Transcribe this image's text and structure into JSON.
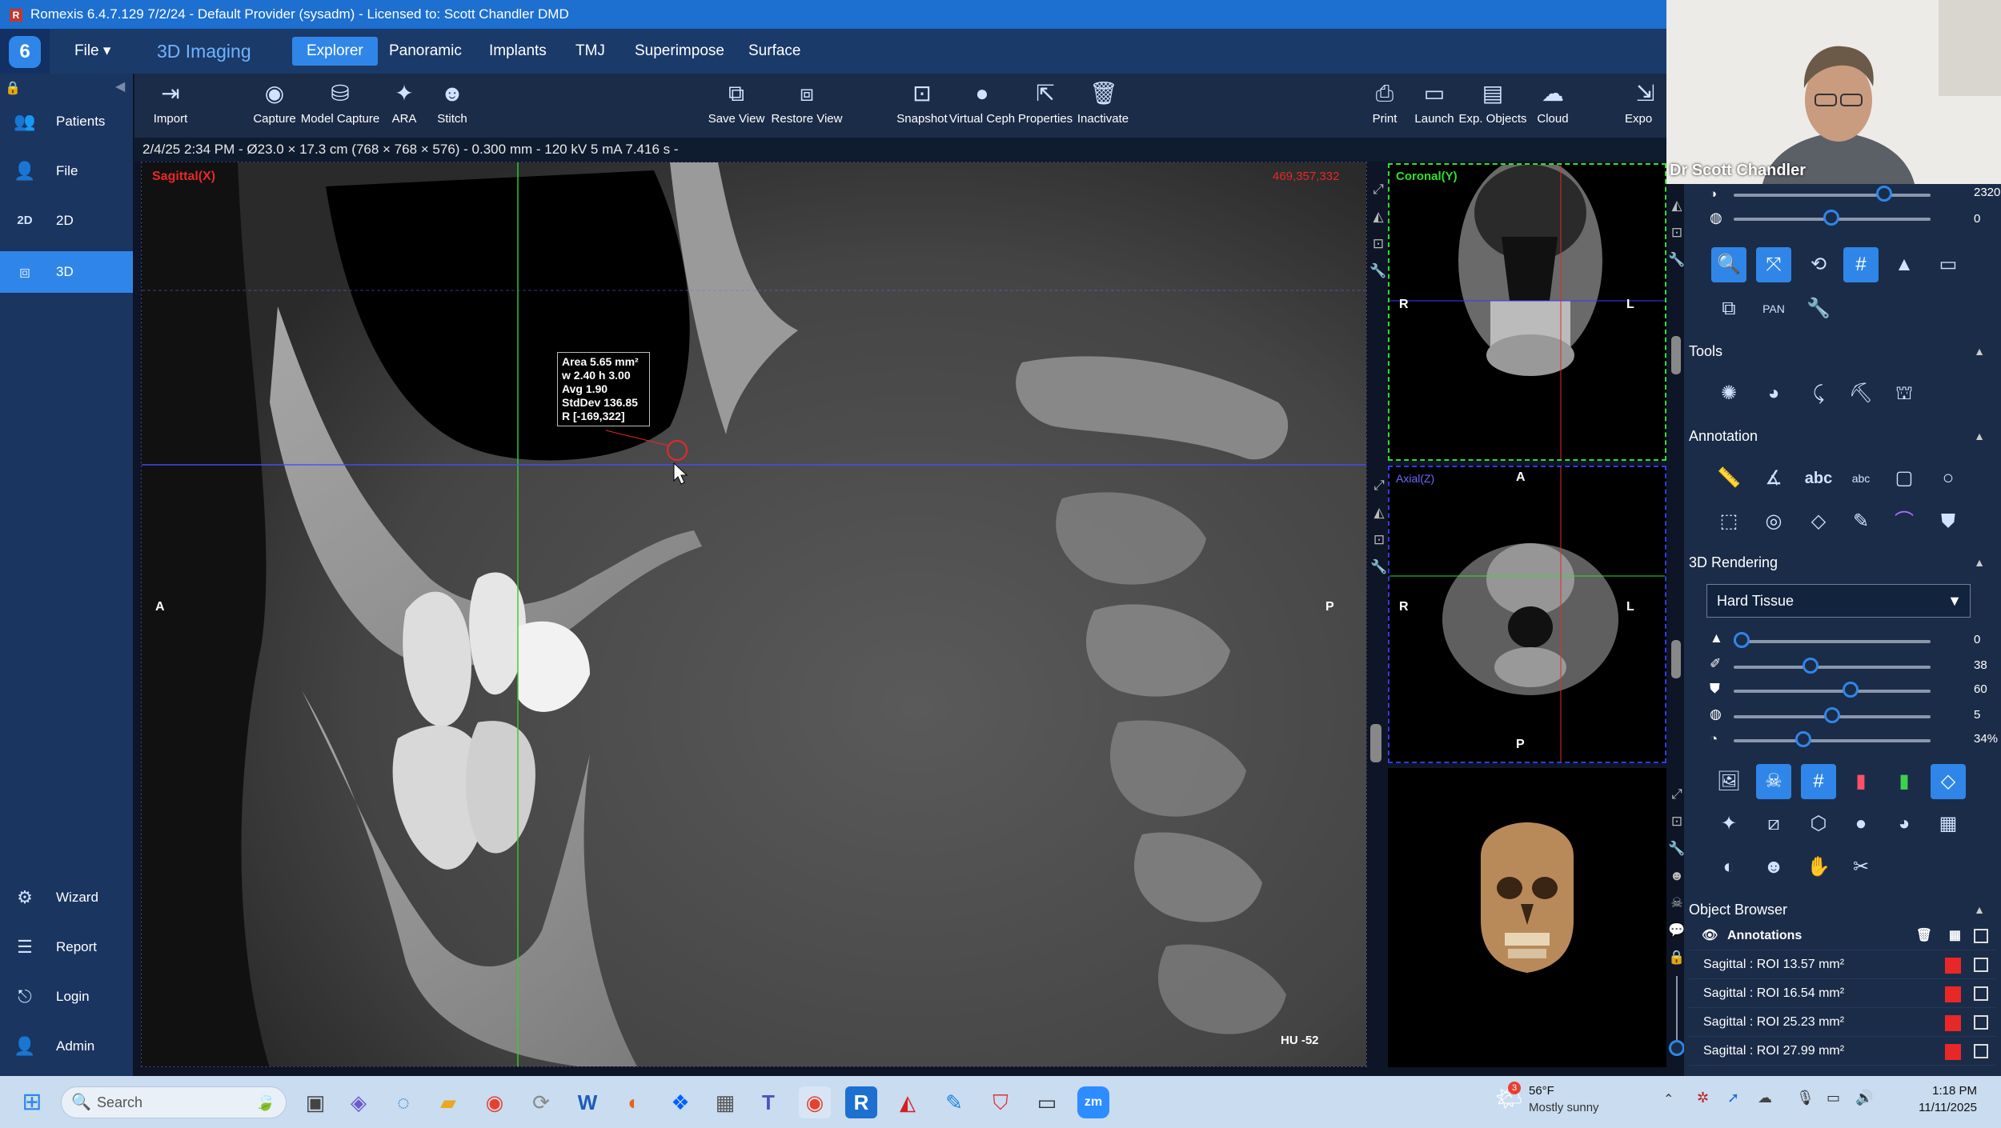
{
  "titlebar": {
    "text": "Romexis 6.4.7.129 7/2/24 - Default Provider (sysadm) - Licensed to: Scott Chandler DMD"
  },
  "topnav": {
    "file": "File",
    "module": "3D Imaging",
    "tabs": [
      "Explorer",
      "Panoramic",
      "Implants",
      "TMJ",
      "Superimpose",
      "Surface"
    ],
    "active_tab": "Explorer"
  },
  "toolbar": {
    "import": "Import",
    "capture": "Capture",
    "model_capture": "Model Capture",
    "ara": "ARA",
    "stitch": "Stitch",
    "save_view": "Save View",
    "restore_view": "Restore View",
    "snapshot": "Snapshot",
    "virtual_ceph": "Virtual Ceph",
    "properties": "Properties",
    "inactivate": "Inactivate",
    "print": "Print",
    "launch": "Launch",
    "exp_objects": "Exp. Objects",
    "cloud": "Cloud",
    "expo": "Expo"
  },
  "sidebar": {
    "top": [
      {
        "label": "Patients",
        "icon": "people-icon"
      },
      {
        "label": "File",
        "icon": "person-icon"
      },
      {
        "label": "2D",
        "icon": "2d-icon"
      },
      {
        "label": "3D",
        "icon": "3d-icon"
      }
    ],
    "bottom": [
      {
        "label": "Wizard",
        "icon": "wizard-icon"
      },
      {
        "label": "Report",
        "icon": "report-icon"
      },
      {
        "label": "Login",
        "icon": "login-icon"
      },
      {
        "label": "Admin",
        "icon": "admin-icon"
      }
    ]
  },
  "status_line": "2/4/25 2:34 PM - Ø23.0 × 17.3 cm (768 × 768 × 576) - 0.300 mm - 120 kV 5 mA 7.416 s -",
  "main_view": {
    "label": "Sagittal(X)",
    "coords": "469,357,332",
    "left_marker": "A",
    "right_marker": "P",
    "hu": "HU -52",
    "roi_lines": [
      "Area 5.65 mm²",
      "w 2.40 h 3.00",
      "Avg 1.90",
      "StdDev 136.85",
      "R [-169,322]"
    ]
  },
  "coronal_view": {
    "label": "Coronal(Y)",
    "left": "R",
    "right": "L"
  },
  "axial_view": {
    "label": "Axial(Z)",
    "top": "A",
    "bottom": "P",
    "left": "R",
    "right": "L"
  },
  "right_panel": {
    "top_slider_values": [
      "2320",
      "0"
    ],
    "tools_title": "Tools",
    "annotation_title": "Annotation",
    "rendering_title": "3D Rendering",
    "rendering_select": "Hard Tissue",
    "render_sliders": [
      {
        "value": "0",
        "level": 0.0
      },
      {
        "value": "38",
        "level": 0.38
      },
      {
        "value": "60",
        "level": 0.6
      },
      {
        "value": "5",
        "level": 0.5
      },
      {
        "value": "34%",
        "level": 0.34
      }
    ],
    "object_browser_title": "Object Browser",
    "annotations_label": "Annotations",
    "objects": [
      "Sagittal : ROI 13.57 mm²",
      "Sagittal : ROI 16.54 mm²",
      "Sagittal : ROI 25.23 mm²",
      "Sagittal : ROI 27.99 mm²"
    ]
  },
  "webcam": {
    "name": "Dr Scott Chandler"
  },
  "taskbar": {
    "search": "Search",
    "weather_temp": "56°F",
    "weather_desc": "Mostly sunny",
    "time": "1:18 PM",
    "date": "11/11/2025",
    "weather_badge": "3"
  },
  "colors": {
    "accent": "#2f86e8",
    "titlebar": "#1d6fd0",
    "roi": "#e82828"
  }
}
